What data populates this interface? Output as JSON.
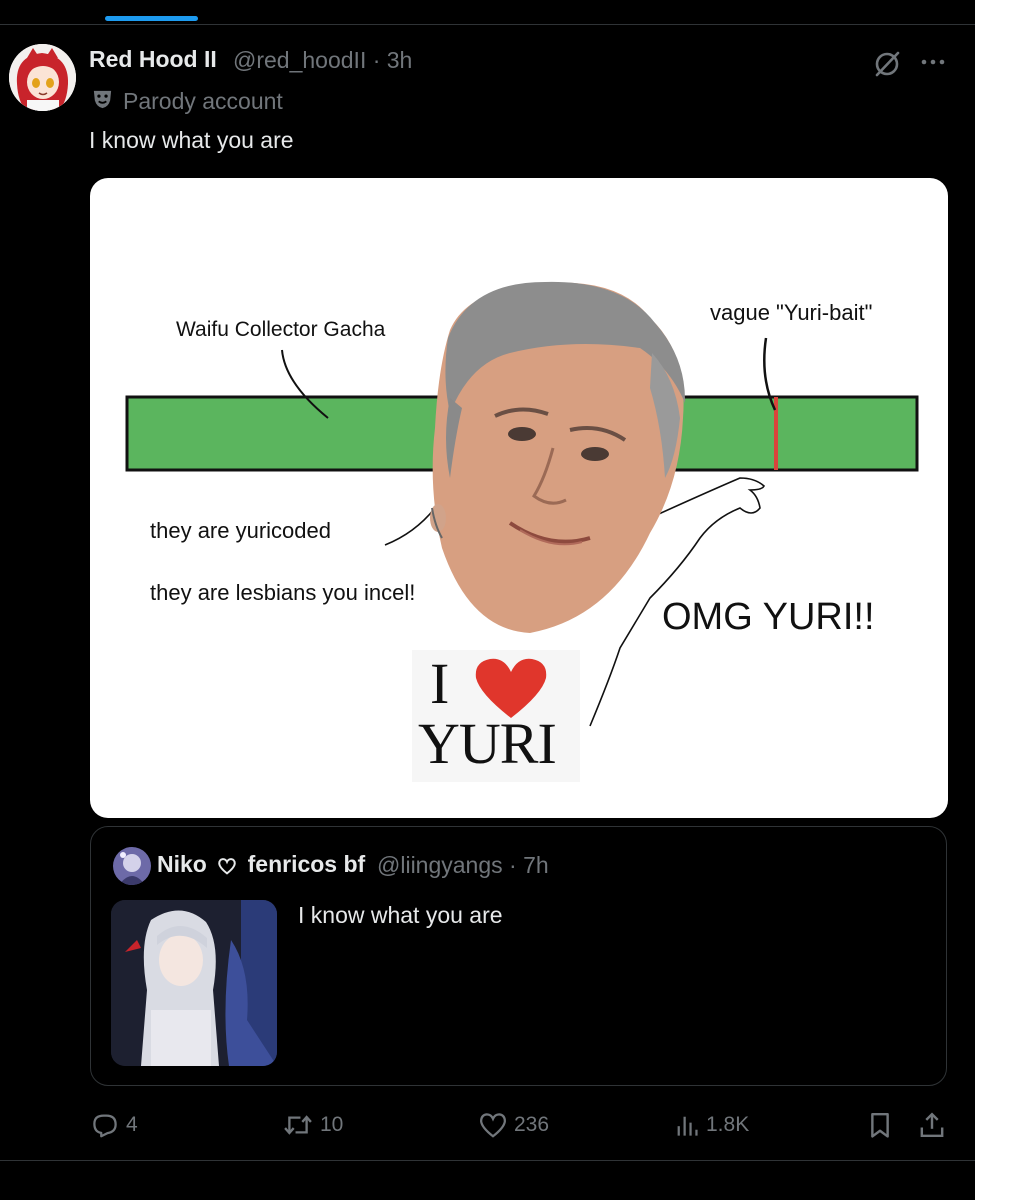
{
  "post": {
    "author_name": "Red Hood II",
    "handle_time": "@red_hoodII · 3h",
    "badge_label": "Parody account",
    "text": "I know what you are"
  },
  "meme": {
    "label_waifu": "Waifu Collector Gacha",
    "label_vague": "vague \"Yuri-bait\"",
    "label_yuricoded": "they are yuricoded",
    "label_lesbians": "they are lesbians you incel!",
    "label_omg": "OMG YURI!!",
    "sign_i": "I",
    "sign_yuri": "YURI",
    "colors": {
      "bar": "#5bb55e",
      "marker": "#d9443b",
      "heart": "#e0362c"
    }
  },
  "quote": {
    "author_name": "Niko",
    "author_name_suffix": "fenricos bf",
    "handle_time": "@liingyangs · 7h",
    "text": "I know what you are"
  },
  "actions": {
    "replies": "4",
    "reposts": "10",
    "likes": "236",
    "views": "1.8K"
  },
  "icons": [
    "grok-icon",
    "more-icon",
    "parody-mask-icon",
    "heart-outline-icon",
    "reply-icon",
    "repost-icon",
    "like-icon",
    "views-icon",
    "bookmark-icon",
    "share-icon"
  ],
  "colors": {
    "background": "#000000",
    "text": "#e7e9ea",
    "secondary": "#71767b",
    "accent": "#1d9bf0",
    "border": "#2f3336"
  }
}
